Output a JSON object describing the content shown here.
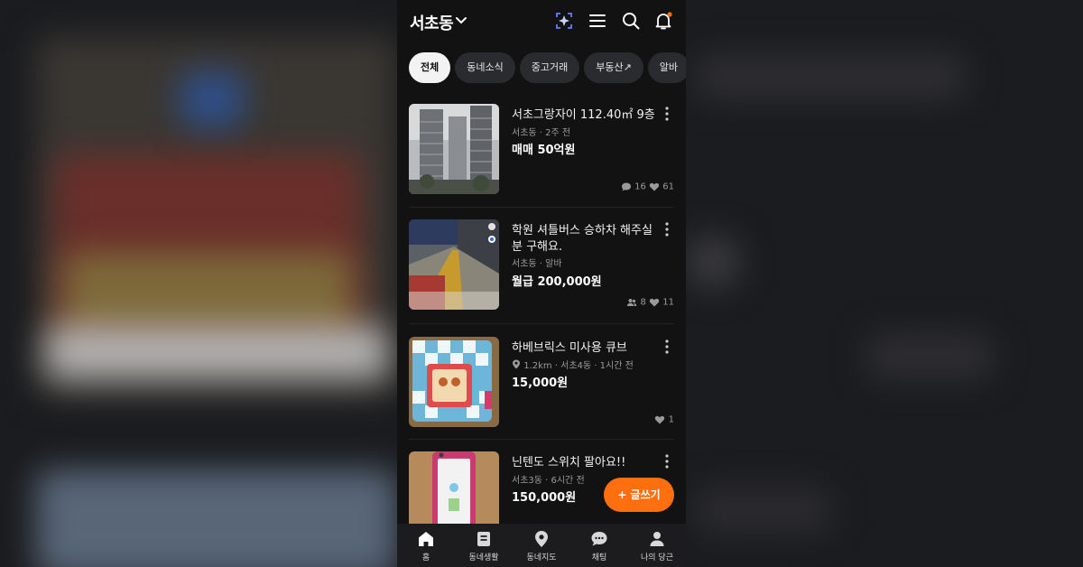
{
  "header": {
    "location": "서초동"
  },
  "chips": [
    {
      "label": "전체",
      "active": true
    },
    {
      "label": "동네소식",
      "active": false
    },
    {
      "label": "중고거래",
      "active": false
    },
    {
      "label": "부동산↗",
      "active": false
    },
    {
      "label": "알바",
      "active": false
    }
  ],
  "items": [
    {
      "title": "서초그랑자이 112.40㎡ 9층",
      "meta": "서초동 · 2주 전",
      "price": "매매 50억원",
      "chats": "16",
      "likes": "61"
    },
    {
      "title": "학원 셔틀버스 승하차 해주실분 구해요.",
      "meta": "서초동 · 알바",
      "price": "월급 200,000원",
      "applicants": "8",
      "likes": "11"
    },
    {
      "title": "하베브릭스 미사용 큐브",
      "meta": "1.2km · 서초4동 · 1시간 전",
      "price": "15,000원",
      "likes": "1"
    },
    {
      "title": "닌텐도 스위치 팔아요!!",
      "meta": "서초3동 · 6시간 전",
      "price": "150,000원"
    }
  ],
  "fab": {
    "label": "+ 글쓰기"
  },
  "nav": [
    {
      "label": "홈",
      "icon": "home-icon"
    },
    {
      "label": "동네생활",
      "icon": "board-icon"
    },
    {
      "label": "동네지도",
      "icon": "map-pin-icon"
    },
    {
      "label": "채팅",
      "icon": "chat-icon"
    },
    {
      "label": "나의 당근",
      "icon": "person-icon"
    }
  ],
  "colors": {
    "accent": "#ff6f0f",
    "background": "#121212",
    "sparkle": "#6b7cff"
  }
}
